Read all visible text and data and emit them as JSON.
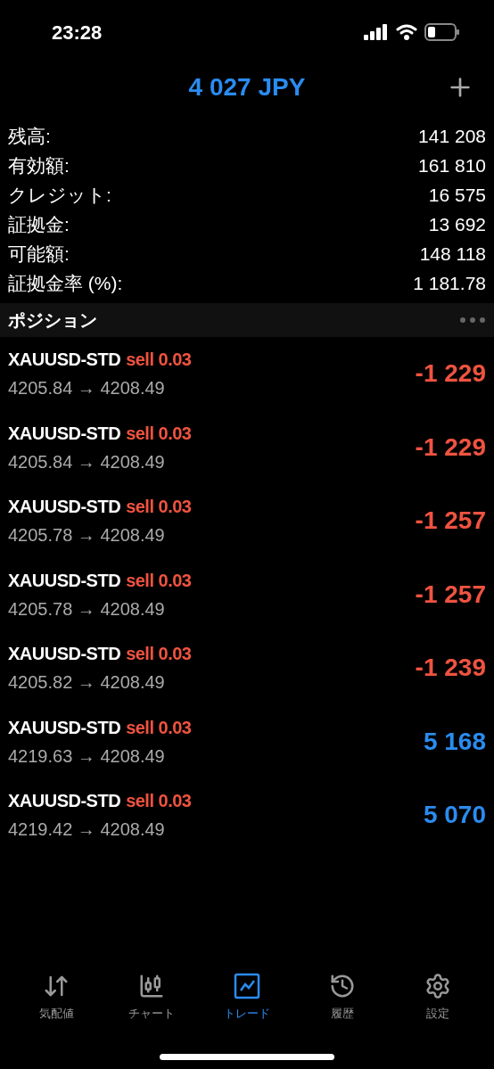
{
  "status_bar": {
    "time": "23:28"
  },
  "header": {
    "title": "4 027 JPY"
  },
  "summary": [
    {
      "label": "残高:",
      "value": "141 208"
    },
    {
      "label": "有効額:",
      "value": "161 810"
    },
    {
      "label": "クレジット:",
      "value": "16 575"
    },
    {
      "label": "証拠金:",
      "value": "13 692"
    },
    {
      "label": "可能額:",
      "value": "148 118"
    },
    {
      "label": "証拠金率 (%):",
      "value": "1 181.78"
    }
  ],
  "section": {
    "title": "ポジション"
  },
  "positions": [
    {
      "symbol": "XAUUSD-STD",
      "side": "sell 0.03",
      "prices": "4205.84 → 4208.49",
      "profit": "-1 229",
      "kind": "loss"
    },
    {
      "symbol": "XAUUSD-STD",
      "side": "sell 0.03",
      "prices": "4205.84 → 4208.49",
      "profit": "-1 229",
      "kind": "loss"
    },
    {
      "symbol": "XAUUSD-STD",
      "side": "sell 0.03",
      "prices": "4205.78 → 4208.49",
      "profit": "-1 257",
      "kind": "loss"
    },
    {
      "symbol": "XAUUSD-STD",
      "side": "sell 0.03",
      "prices": "4205.78 → 4208.49",
      "profit": "-1 257",
      "kind": "loss"
    },
    {
      "symbol": "XAUUSD-STD",
      "side": "sell 0.03",
      "prices": "4205.82 → 4208.49",
      "profit": "-1 239",
      "kind": "loss"
    },
    {
      "symbol": "XAUUSD-STD",
      "side": "sell 0.03",
      "prices": "4219.63 → 4208.49",
      "profit": "5 168",
      "kind": "profit"
    },
    {
      "symbol": "XAUUSD-STD",
      "side": "sell 0.03",
      "prices": "4219.42 → 4208.49",
      "profit": "5 070",
      "kind": "profit"
    }
  ],
  "tab_bar": [
    {
      "label": "気配値",
      "kind": "quotes",
      "selected": false
    },
    {
      "label": "チャート",
      "kind": "chart",
      "selected": false
    },
    {
      "label": "トレード",
      "kind": "trade",
      "selected": true
    },
    {
      "label": "履歴",
      "kind": "history",
      "selected": false
    },
    {
      "label": "設定",
      "kind": "settings",
      "selected": false
    }
  ]
}
